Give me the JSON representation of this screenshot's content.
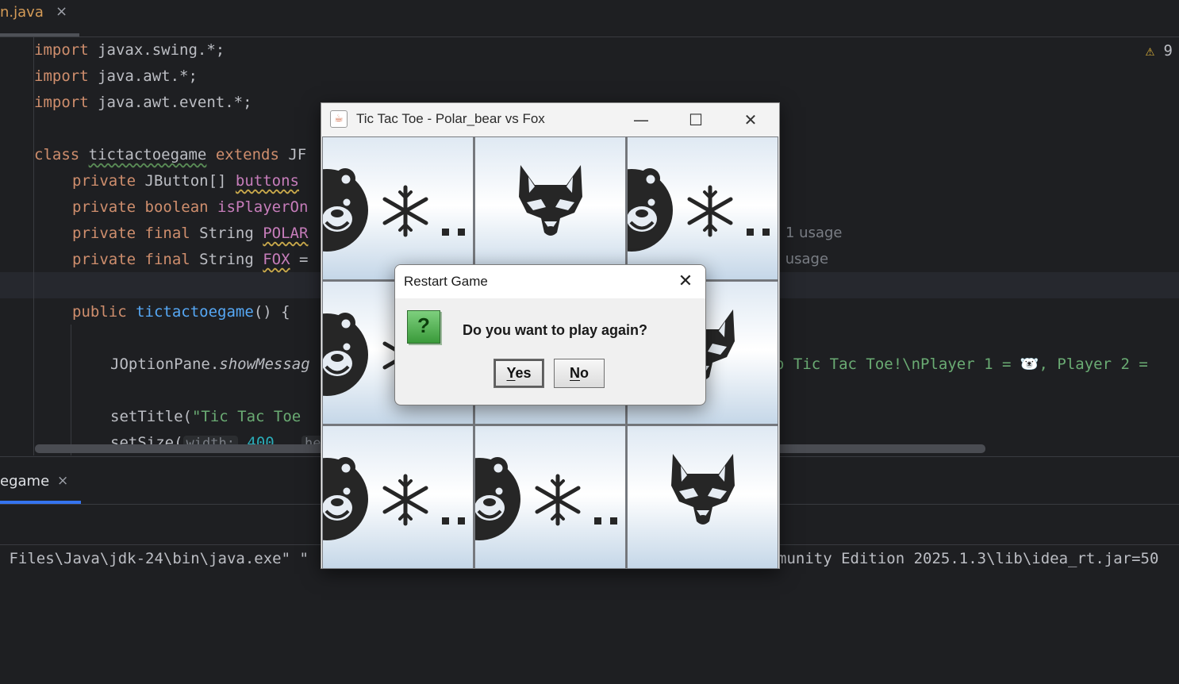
{
  "editor": {
    "tab_label": "n.java",
    "tab_close": "×",
    "warning_count": "9",
    "lines": {
      "l1a": "import",
      "l1b": " javax.swing.*;",
      "l2a": "import",
      "l2b": " java.awt.*;",
      "l3a": "import",
      "l3b": " java.awt.event.*;",
      "l5a": "class",
      "l5b": "tictactoegame",
      "l5c": "extends",
      "l5d": " JF",
      "l6a": "private",
      "l6b": " JButton[] ",
      "l6c": "buttons",
      "l7a": "private boolean",
      "l7b": " isPlayerOn",
      "l8a": "private final",
      "l8b": " String ",
      "l8c": "POLAR",
      "l9a": "private final",
      "l9b": " String ",
      "l9c": "FOX",
      "l9d": " =",
      "l11a": "public",
      "l11b": "tictactoegame",
      "l11c": "() {  ",
      "l13a": "JOptionPane.",
      "l13b": "showMessag",
      "l13c": "o Tic Tac Toe!\\nPlayer 1 = 🐻‍❄️, Player 2 =",
      "l15a": "setTitle(",
      "l15b": "\"Tic Tac Toe ",
      "l16a": "setSize(",
      "l16b": "width:",
      "l16c": "400",
      "l16d": ",  ",
      "l16e": "he"
    },
    "usage_1": "1 usage",
    "usage_2": "l usage"
  },
  "run_panel": {
    "tab_label": "egame",
    "tab_close": "×",
    "console_left": " Files\\Java\\jdk-24\\bin\\java.exe\" \"",
    "console_right": "munity Edition 2025.1.3\\lib\\idea_rt.jar=50"
  },
  "game_window": {
    "title": "Tic Tac Toe - Polar_bear vs Fox",
    "minimize": "—",
    "maximize": "☐",
    "close": "✕",
    "board": [
      "polar_bear",
      "fox",
      "polar_bear",
      "polar_bear",
      "",
      "fox",
      "polar_bear",
      "polar_bear",
      "fox"
    ]
  },
  "dialog": {
    "title": "Restart Game",
    "close": "✕",
    "icon": "?",
    "message": "Do you want to play again?",
    "yes_mnemonic": "Y",
    "yes_rest": "es",
    "no_mnemonic": "N",
    "no_rest": "o"
  }
}
